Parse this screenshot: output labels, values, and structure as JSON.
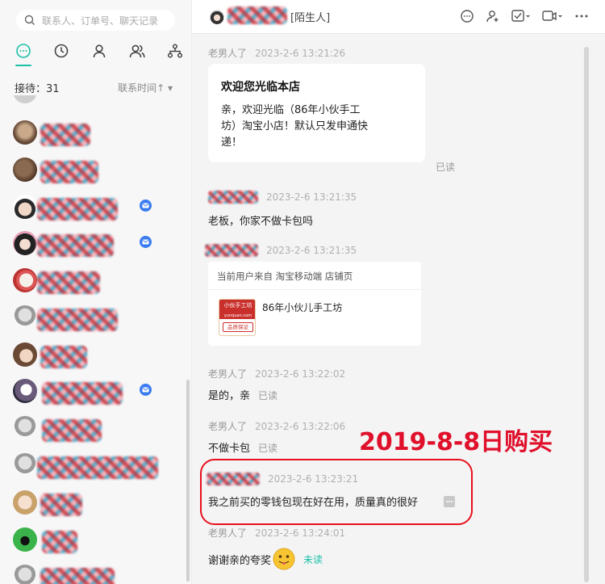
{
  "sidebar": {
    "search_placeholder": "联系人、订单号、聊天记录",
    "nav_tabs": [
      "chat-icon",
      "clock-icon",
      "person-icon",
      "group-icon",
      "org-icon"
    ],
    "reception_label": "接待：31",
    "sort_label": "联系时间↑ ▾"
  },
  "header": {
    "tag": "[陌生人]"
  },
  "messages": [
    {
      "sender": "老男人了",
      "time": "2023-2-6 13:21:26"
    },
    {
      "title": "欢迎您光临本店",
      "text_line1": "亲，欢迎光临（86年小伙手工",
      "text_line2": "坊）淘宝小店！默认只发申通快",
      "text_line3": "递！",
      "status": "已读"
    },
    {
      "time": "2023-2-6 13:21:35",
      "text": "老板，你家不做卡包吗"
    },
    {
      "time": "2023-2-6 13:21:35",
      "card_title": "当前用户来自 淘宝移动端 店铺页",
      "shop_name": "86年小伙儿手工坊",
      "logo_text": "小伙手工坊",
      "logo_sub": "yunquan.com",
      "logo_badge": "品质保证"
    },
    {
      "sender": "老男人了",
      "time": "2023-2-6 13:22:02",
      "text": "是的，亲",
      "status": "已读"
    },
    {
      "sender": "老男人了",
      "time": "2023-2-6 13:22:06",
      "text": "不做卡包",
      "status": "已读"
    },
    {
      "time": "2023-2-6 13:23:21",
      "text": "我之前买的零钱包现在好在用，质量真的很好"
    },
    {
      "sender": "老男人了",
      "time": "2023-2-6 13:24:01",
      "text": "谢谢亲的夸奖",
      "status": "未读"
    }
  ],
  "annotation": "2019-8-8日购买",
  "colors": {
    "accent": "#1bc0a6",
    "annotation_red": "#e0102b",
    "badge_blue": "#3a7bf0"
  }
}
